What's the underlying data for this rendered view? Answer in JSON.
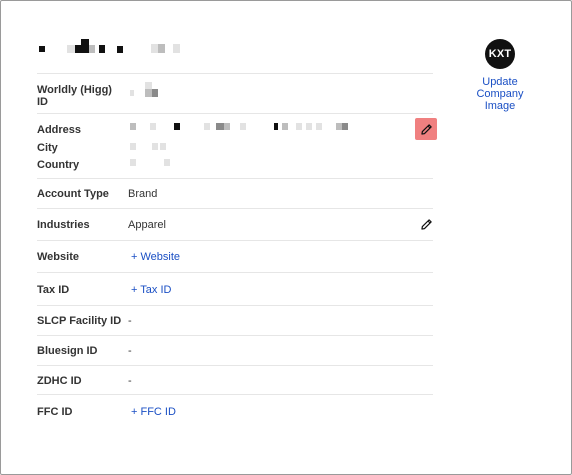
{
  "company": {
    "logo_initials": "KXT",
    "update_image_label": "Update Company Image"
  },
  "fields": {
    "worldly_label": "Worldly (Higg) ID",
    "address_label": "Address",
    "city_label": "City",
    "country_label": "Country",
    "account_type_label": "Account Type",
    "account_type_value": "Brand",
    "industries_label": "Industries",
    "industries_value": "Apparel",
    "website_label": "Website",
    "website_add": "+ Website",
    "tax_id_label": "Tax ID",
    "tax_id_add": "+ Tax ID",
    "slcp_label": "SLCP Facility ID",
    "slcp_value": "-",
    "bluesign_label": "Bluesign ID",
    "bluesign_value": "-",
    "zdhc_label": "ZDHC ID",
    "zdhc_value": "-",
    "ffc_label": "FFC ID",
    "ffc_add": "+ FFC ID"
  },
  "colors": {
    "link": "#1a4fc4",
    "edit_highlight": "#f08080"
  },
  "icons": {
    "edit": "pencil-icon"
  }
}
